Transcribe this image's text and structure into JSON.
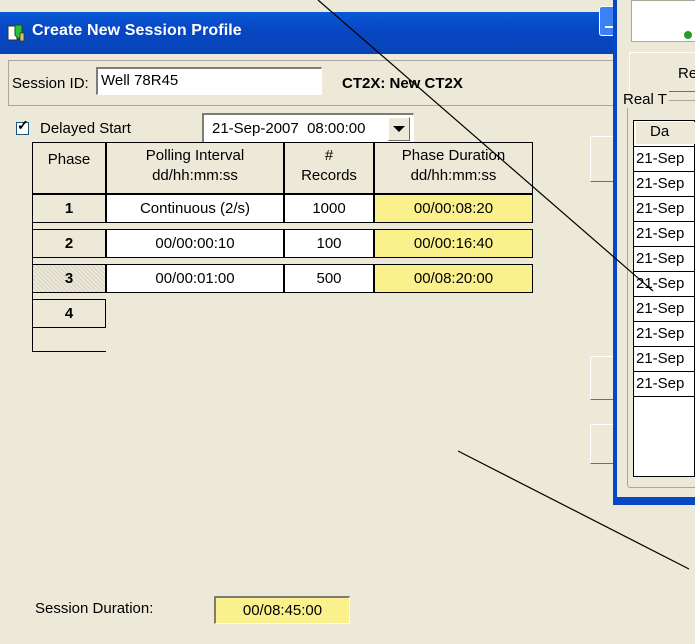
{
  "dialog": {
    "title": "Create New Session Profile",
    "session_id_label": "Session ID:",
    "session_id_value": "Well 78R45",
    "device_label": "CT2X: New CT2X",
    "delayed_start_label": "Delayed Start",
    "delayed_start_checked": true,
    "start_datetime": "21-Sep-2007  08:00:00",
    "table": {
      "headers": {
        "phase": "Phase",
        "polling_1": "Polling Interval",
        "polling_2": "dd/hh:mm:ss",
        "records_1": "#",
        "records_2": "Records",
        "duration_1": "Phase Duration",
        "duration_2": "dd/hh:mm:ss"
      },
      "rows": [
        {
          "phase": "1",
          "polling": "Continuous (2/s)",
          "records": "1000",
          "duration": "00/00:08:20"
        },
        {
          "phase": "2",
          "polling": "00/00:00:10",
          "records": "100",
          "duration": "00/00:16:40"
        },
        {
          "phase": "3",
          "polling": "00/00:01:00",
          "records": "500",
          "duration": "00/08:20:00"
        },
        {
          "phase": "4",
          "polling": "",
          "records": "",
          "duration": ""
        }
      ],
      "selected_phase": "3"
    },
    "session_duration_label": "Session Duration:",
    "session_duration_value": "00/08:45:00"
  },
  "right_window": {
    "button_fragment": "Re",
    "group_label_fragment": "Real T",
    "list_header_fragment": "Da",
    "list_rows": [
      "21-Sep",
      "21-Sep",
      "21-Sep",
      "21-Sep",
      "21-Sep",
      "21-Sep",
      "21-Sep",
      "21-Sep",
      "21-Sep",
      "21-Sep"
    ]
  },
  "colors": {
    "titlebar": "#0747c4",
    "highlight_yellow": "#fbf18c",
    "window_bg": "#ece9d8"
  },
  "icons": {
    "title": "session-profile-icon",
    "check": "checkmark-icon",
    "dropdown": "chevron-down-icon"
  }
}
